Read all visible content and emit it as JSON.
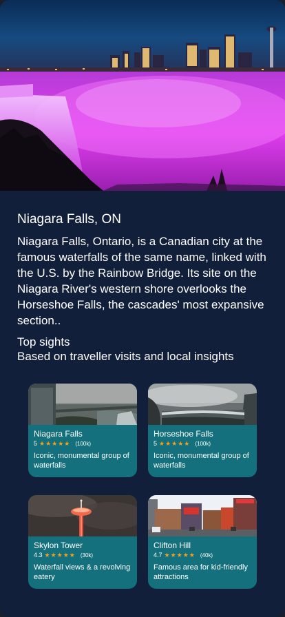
{
  "place": {
    "title": "Niagara Falls, ON",
    "description": "Niagara Falls, Ontario, is a Canadian city at the famous waterfalls of the same name, linked with the U.S. by the Rainbow Bridge. Its site on the Niagara River's western shore overlooks the Horseshoe Falls, the cascades' most expansive section.."
  },
  "top_sights": {
    "heading": "Top sights",
    "subheading": "Based on traveller visits and local insights",
    "cards": [
      {
        "name": "Niagara Falls",
        "rating": "5",
        "stars": "★★★★★",
        "reviews": "(100k)",
        "description": "Iconic, monumental group of waterfalls"
      },
      {
        "name": "Horseshoe Falls",
        "rating": "5",
        "stars": "★★★★★",
        "reviews": "(100k)",
        "description": "Iconic, monumental group of waterfalls"
      },
      {
        "name": "Skylon Tower",
        "rating": "4.3",
        "stars": "★★★★★",
        "reviews": "(30k)",
        "description": "Waterfall views & a revolving eatery"
      },
      {
        "name": "Clifton Hill",
        "rating": "4.7",
        "stars": "★★★★★",
        "reviews": "(40k)",
        "description": "Famous area for kid-friendly attractions"
      }
    ]
  },
  "colors": {
    "background": "#121f3a",
    "card": "#14707c",
    "star": "#f4a11d",
    "text": "#ffffff"
  }
}
